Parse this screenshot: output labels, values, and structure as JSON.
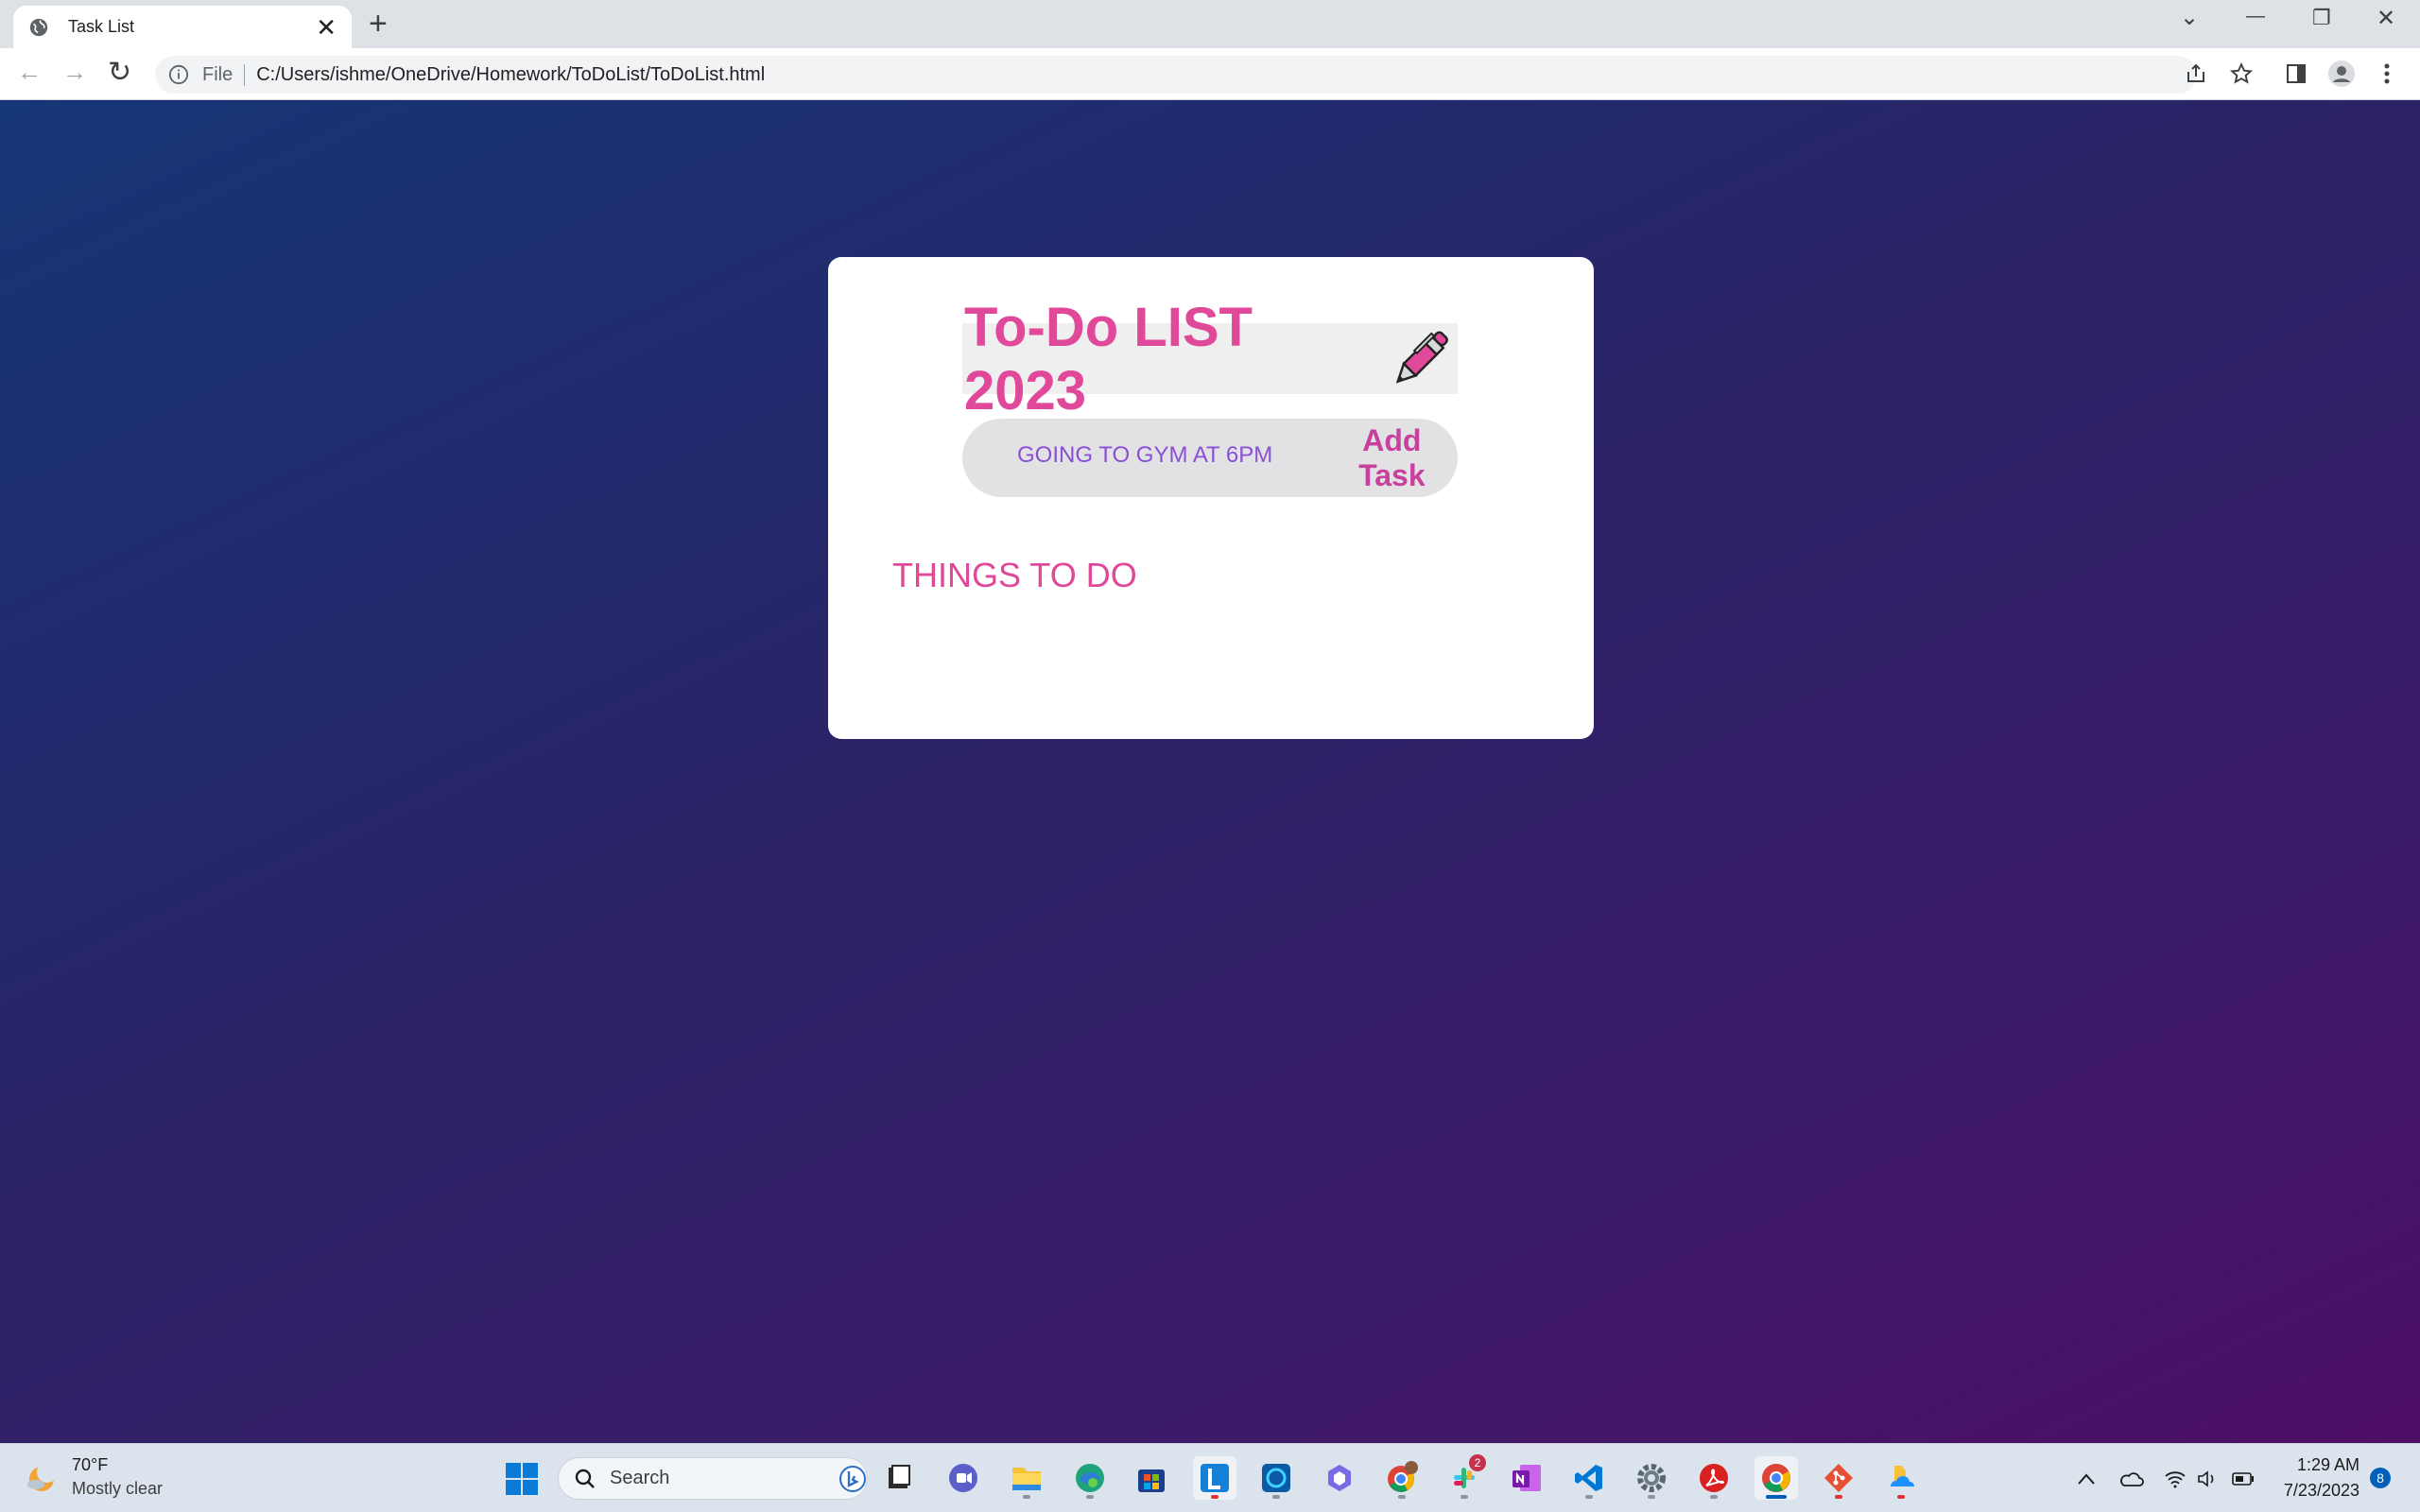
{
  "browser": {
    "tab_title": "Task List",
    "tab_close": "✕",
    "new_tab": "+",
    "window_controls": {
      "tab_search": "⌄",
      "minimize": "—",
      "restore": "❐",
      "close": "✕"
    },
    "back": "←",
    "forward": "→",
    "reload": "↻",
    "file_label": "File",
    "url": "C:/Users/ishme/OneDrive/Homework/ToDoList/ToDoList.html",
    "toolbar_icons": [
      "share-icon",
      "star-icon",
      "side-panel-icon",
      "profile-icon",
      "more-menu-icon"
    ]
  },
  "page": {
    "heading": "To-Do LIST 2023",
    "heading_icon": "pen-icon",
    "input_value": "GOING TO GYM AT 6PM",
    "add_button": "Add Task",
    "list_title": "THINGS TO DO",
    "colors": {
      "accent_pink": "#e0489a",
      "add_button": "#c8409e",
      "input_text": "#8a4fd4",
      "bg_start": "#153677",
      "bg_end": "#4e0f66"
    }
  },
  "taskbar": {
    "weather_temp": "70°F",
    "weather_desc": "Mostly clear",
    "search_label": "Search",
    "apps": [
      "file-viewer-icon",
      "teams-icon",
      "file-explorer-icon",
      "edge-icon",
      "store-icon",
      "app-l-icon",
      "cortana-icon",
      "copilot-icon",
      "chrome-profile-icon",
      "slack-icon",
      "onenote-icon",
      "vscode-icon",
      "settings-icon",
      "acrobat-icon",
      "chrome-icon",
      "git-icon",
      "onedrive-icon"
    ],
    "slack_badge": "2",
    "time": "1:29 AM",
    "date": "7/23/2023",
    "notification_count": "8"
  }
}
